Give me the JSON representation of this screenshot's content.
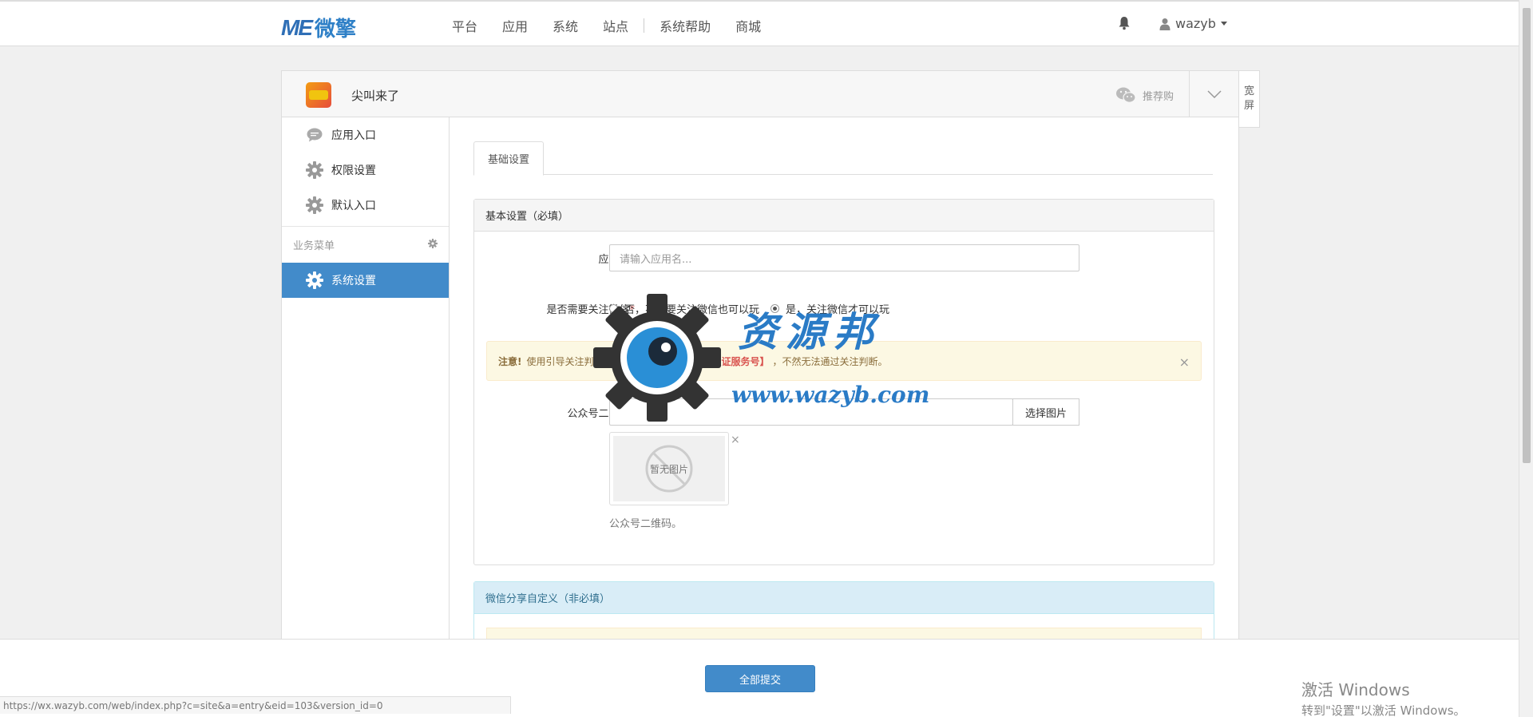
{
  "brand": {
    "mark": "ME",
    "name": "微擎"
  },
  "nav": {
    "items": [
      "平台",
      "应用",
      "系统",
      "站点",
      "系统帮助",
      "商城"
    ]
  },
  "user": {
    "name": "wazyb"
  },
  "app": {
    "name": "尖叫来了",
    "recommend": "推荐购"
  },
  "wide_button": {
    "line1": "宽",
    "line2": "屏"
  },
  "sidebar": {
    "items": [
      {
        "label": "应用入口",
        "icon": "chat-icon"
      },
      {
        "label": "权限设置",
        "icon": "gear-icon"
      },
      {
        "label": "默认入口",
        "icon": "gear-icon"
      }
    ],
    "group_label": "业务菜单",
    "active_item": {
      "label": "系统设置",
      "icon": "gear-icon"
    }
  },
  "tabs": {
    "active": "基础设置"
  },
  "basic_section": {
    "title": "基本设置（必填）",
    "app_name_label": "应用名",
    "app_name_placeholder": "请输入应用名...",
    "follow_label": "是否需要关注微信",
    "radio_no": "否，不需要关注微信也可以玩",
    "radio_yes": "是，关注微信才可以玩",
    "selected": "yes",
    "alert": {
      "strong": "注意!",
      "text_before": "使用引导关注判断功能，公众号需要",
      "link": "【微信认证服务号】",
      "text_after": "，不然无法通过关注判断。"
    },
    "qrcode_label": "公众号二维码",
    "choose_image": "选择图片",
    "no_image": "暂无图片",
    "remove": "×",
    "qrcode_help": "公众号二维码。"
  },
  "share_section": {
    "title": "微信分享自定义（非必填）"
  },
  "watermark": {
    "title": "资源邦",
    "url": "www.wazyb.com"
  },
  "footer": {
    "submit": "全部提交"
  },
  "status_bar": {
    "url": "https://wx.wazyb.com/web/index.php?c=site&a=entry&eid=103&version_id=0"
  },
  "windows_activation": {
    "line1": "激活 Windows",
    "line2": "转到\"设置\"以激活 Windows。"
  },
  "colors": {
    "primary": "#428bca",
    "brand": "#2f6fb6",
    "required": "#d9534f",
    "alert_bg": "#fcf8e3"
  }
}
